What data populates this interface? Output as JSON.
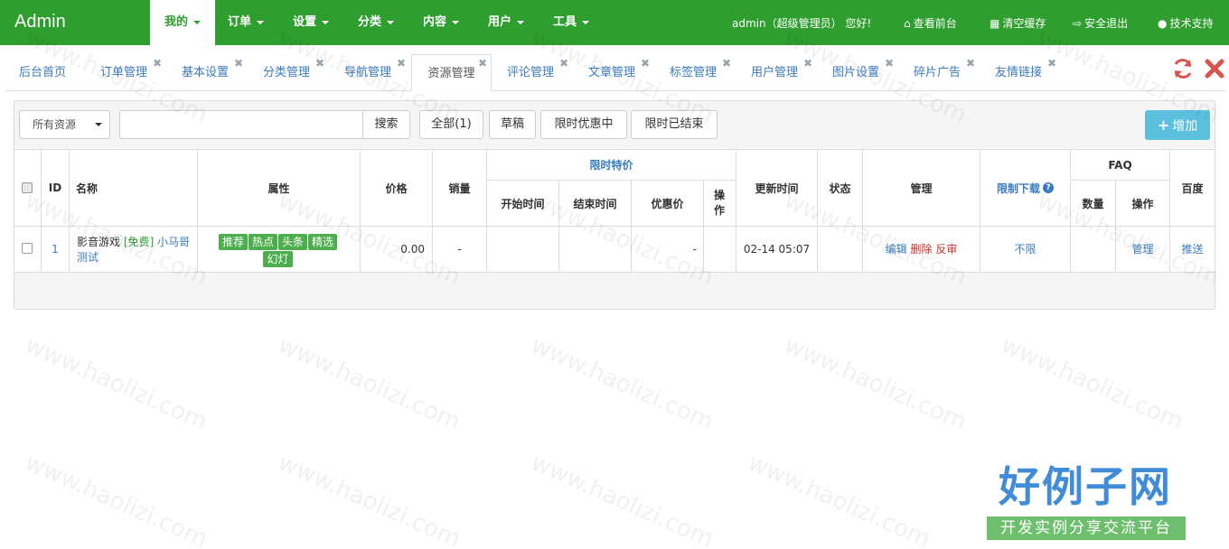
{
  "brand": "Admin",
  "nav": {
    "menus": [
      {
        "label": "我的",
        "active": true
      },
      {
        "label": "订单",
        "active": false
      },
      {
        "label": "设置",
        "active": false
      },
      {
        "label": "分类",
        "active": false
      },
      {
        "label": "内容",
        "active": false
      },
      {
        "label": "用户",
        "active": false
      },
      {
        "label": "工具",
        "active": false
      }
    ],
    "greeting": "admin（超级管理员） 您好!",
    "view_front": "查看前台",
    "clear_cache": "清空缓存",
    "logout": "安全退出",
    "support": "技术支持"
  },
  "tabs": [
    {
      "label": "后台首页",
      "closable": false
    },
    {
      "label": "订单管理",
      "closable": true
    },
    {
      "label": "基本设置",
      "closable": true
    },
    {
      "label": "分类管理",
      "closable": true
    },
    {
      "label": "导航管理",
      "closable": true
    },
    {
      "label": "资源管理",
      "closable": true,
      "active": true
    },
    {
      "label": "评论管理",
      "closable": true
    },
    {
      "label": "文章管理",
      "closable": true
    },
    {
      "label": "标签管理",
      "closable": true
    },
    {
      "label": "用户管理",
      "closable": true
    },
    {
      "label": "图片设置",
      "closable": true
    },
    {
      "label": "碎片广告",
      "closable": true
    },
    {
      "label": "友情链接",
      "closable": true
    }
  ],
  "toolbar": {
    "filter_select": "所有资源",
    "search_placeholder": "",
    "search_button": "搜索",
    "all_button": "全部(1)",
    "draft_button": "草稿",
    "promo_active_button": "限时优惠中",
    "promo_ended_button": "限时已结束",
    "add_button": "增加"
  },
  "table": {
    "headers": {
      "id": "ID",
      "name": "名称",
      "attrs": "属性",
      "price": "价格",
      "sales": "销量",
      "promo": "限时特价",
      "promo_start": "开始时间",
      "promo_end": "结束时间",
      "promo_price": "优惠价",
      "promo_op": "操作",
      "updated": "更新时间",
      "status": "状态",
      "manage": "管理",
      "download_limit": "限制下载",
      "faq": "FAQ",
      "faq_count": "数量",
      "faq_op": "操作",
      "baidu": "百度"
    },
    "rows": [
      {
        "id": "1",
        "name_prefix": "影音游戏",
        "name_free": "[免费]",
        "name_link": "小马哥测试",
        "tags": [
          "推荐",
          "热点",
          "头条",
          "精选",
          "幻灯"
        ],
        "price": "0.00",
        "sales": "-",
        "promo_start": "",
        "promo_end": "",
        "promo_price": "-",
        "promo_op": "",
        "updated": "02-14 05:07",
        "status": "",
        "actions": {
          "edit": "编辑",
          "delete": "删除",
          "review": "反审"
        },
        "download_limit": "不限",
        "faq_count": "",
        "faq_op": "管理",
        "baidu": "推送"
      }
    ]
  },
  "watermark": {
    "text": "www.haolizi.com",
    "logo_title": "好例子网",
    "logo_sub": "开发实例分享交流平台"
  },
  "colors": {
    "nav_bg": "#2e9e2e",
    "link": "#3a7bbf",
    "tag_bg": "#4cae4c",
    "add_btn": "#5bc0de",
    "delete": "#c9302c"
  }
}
